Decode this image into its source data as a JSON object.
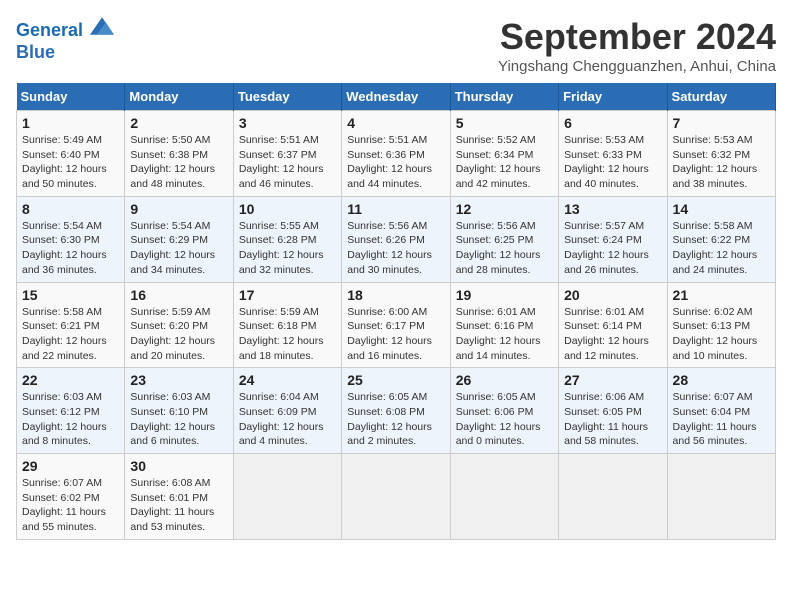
{
  "header": {
    "logo_line1": "General",
    "logo_line2": "Blue",
    "month_title": "September 2024",
    "subtitle": "Yingshang Chengguanzhen, Anhui, China"
  },
  "weekdays": [
    "Sunday",
    "Monday",
    "Tuesday",
    "Wednesday",
    "Thursday",
    "Friday",
    "Saturday"
  ],
  "weeks": [
    [
      {
        "day": "1",
        "sunrise": "5:49 AM",
        "sunset": "6:40 PM",
        "daylight": "12 hours and 50 minutes."
      },
      {
        "day": "2",
        "sunrise": "5:50 AM",
        "sunset": "6:38 PM",
        "daylight": "12 hours and 48 minutes."
      },
      {
        "day": "3",
        "sunrise": "5:51 AM",
        "sunset": "6:37 PM",
        "daylight": "12 hours and 46 minutes."
      },
      {
        "day": "4",
        "sunrise": "5:51 AM",
        "sunset": "6:36 PM",
        "daylight": "12 hours and 44 minutes."
      },
      {
        "day": "5",
        "sunrise": "5:52 AM",
        "sunset": "6:34 PM",
        "daylight": "12 hours and 42 minutes."
      },
      {
        "day": "6",
        "sunrise": "5:53 AM",
        "sunset": "6:33 PM",
        "daylight": "12 hours and 40 minutes."
      },
      {
        "day": "7",
        "sunrise": "5:53 AM",
        "sunset": "6:32 PM",
        "daylight": "12 hours and 38 minutes."
      }
    ],
    [
      {
        "day": "8",
        "sunrise": "5:54 AM",
        "sunset": "6:30 PM",
        "daylight": "12 hours and 36 minutes."
      },
      {
        "day": "9",
        "sunrise": "5:54 AM",
        "sunset": "6:29 PM",
        "daylight": "12 hours and 34 minutes."
      },
      {
        "day": "10",
        "sunrise": "5:55 AM",
        "sunset": "6:28 PM",
        "daylight": "12 hours and 32 minutes."
      },
      {
        "day": "11",
        "sunrise": "5:56 AM",
        "sunset": "6:26 PM",
        "daylight": "12 hours and 30 minutes."
      },
      {
        "day": "12",
        "sunrise": "5:56 AM",
        "sunset": "6:25 PM",
        "daylight": "12 hours and 28 minutes."
      },
      {
        "day": "13",
        "sunrise": "5:57 AM",
        "sunset": "6:24 PM",
        "daylight": "12 hours and 26 minutes."
      },
      {
        "day": "14",
        "sunrise": "5:58 AM",
        "sunset": "6:22 PM",
        "daylight": "12 hours and 24 minutes."
      }
    ],
    [
      {
        "day": "15",
        "sunrise": "5:58 AM",
        "sunset": "6:21 PM",
        "daylight": "12 hours and 22 minutes."
      },
      {
        "day": "16",
        "sunrise": "5:59 AM",
        "sunset": "6:20 PM",
        "daylight": "12 hours and 20 minutes."
      },
      {
        "day": "17",
        "sunrise": "5:59 AM",
        "sunset": "6:18 PM",
        "daylight": "12 hours and 18 minutes."
      },
      {
        "day": "18",
        "sunrise": "6:00 AM",
        "sunset": "6:17 PM",
        "daylight": "12 hours and 16 minutes."
      },
      {
        "day": "19",
        "sunrise": "6:01 AM",
        "sunset": "6:16 PM",
        "daylight": "12 hours and 14 minutes."
      },
      {
        "day": "20",
        "sunrise": "6:01 AM",
        "sunset": "6:14 PM",
        "daylight": "12 hours and 12 minutes."
      },
      {
        "day": "21",
        "sunrise": "6:02 AM",
        "sunset": "6:13 PM",
        "daylight": "12 hours and 10 minutes."
      }
    ],
    [
      {
        "day": "22",
        "sunrise": "6:03 AM",
        "sunset": "6:12 PM",
        "daylight": "12 hours and 8 minutes."
      },
      {
        "day": "23",
        "sunrise": "6:03 AM",
        "sunset": "6:10 PM",
        "daylight": "12 hours and 6 minutes."
      },
      {
        "day": "24",
        "sunrise": "6:04 AM",
        "sunset": "6:09 PM",
        "daylight": "12 hours and 4 minutes."
      },
      {
        "day": "25",
        "sunrise": "6:05 AM",
        "sunset": "6:08 PM",
        "daylight": "12 hours and 2 minutes."
      },
      {
        "day": "26",
        "sunrise": "6:05 AM",
        "sunset": "6:06 PM",
        "daylight": "12 hours and 0 minutes."
      },
      {
        "day": "27",
        "sunrise": "6:06 AM",
        "sunset": "6:05 PM",
        "daylight": "11 hours and 58 minutes."
      },
      {
        "day": "28",
        "sunrise": "6:07 AM",
        "sunset": "6:04 PM",
        "daylight": "11 hours and 56 minutes."
      }
    ],
    [
      {
        "day": "29",
        "sunrise": "6:07 AM",
        "sunset": "6:02 PM",
        "daylight": "11 hours and 55 minutes."
      },
      {
        "day": "30",
        "sunrise": "6:08 AM",
        "sunset": "6:01 PM",
        "daylight": "11 hours and 53 minutes."
      },
      null,
      null,
      null,
      null,
      null
    ]
  ]
}
